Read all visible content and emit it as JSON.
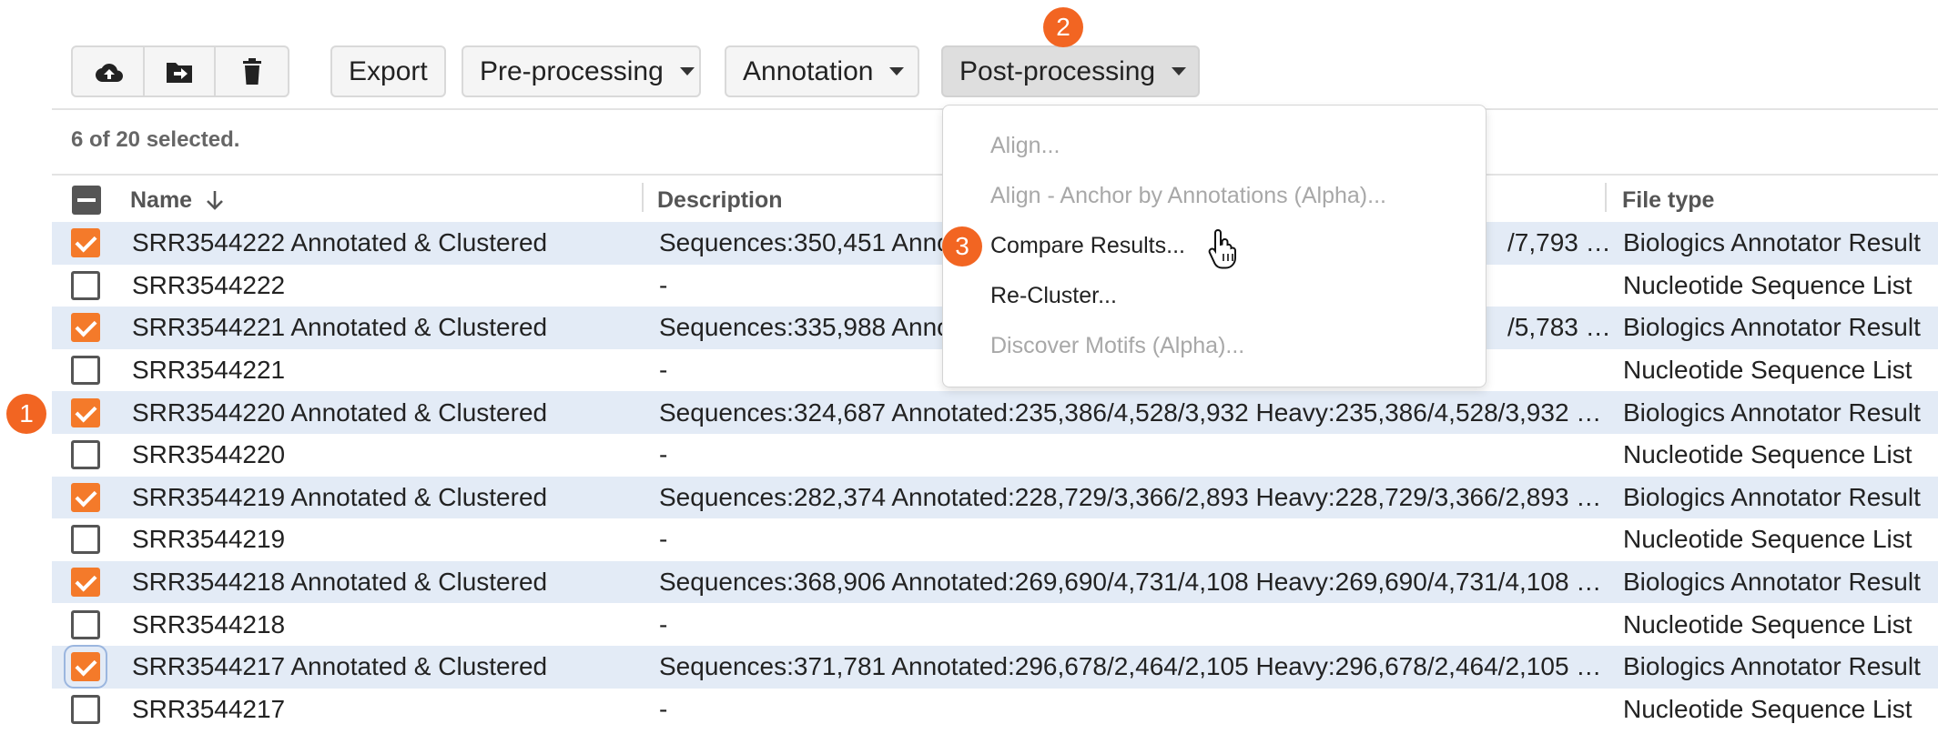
{
  "toolbar": {
    "icons": [
      "upload-cloud-icon",
      "move-to-folder-icon",
      "trash-icon"
    ],
    "export_label": "Export",
    "preprocessing_label": "Pre-processing",
    "annotation_label": "Annotation",
    "postprocessing_label": "Post-processing"
  },
  "selection_status": "6 of 20 selected.",
  "table": {
    "columns": {
      "name": "Name",
      "description": "Description",
      "file_type": "File type"
    },
    "rows": [
      {
        "checked": true,
        "name": "SRR3544222 Annotated & Clustered",
        "description": "Sequences:350,451 Anno",
        "description_tail": "/7,793 …",
        "file_type": "Biologics Annotator Result"
      },
      {
        "checked": false,
        "name": "SRR3544222",
        "description": "-",
        "description_tail": "",
        "file_type": "Nucleotide Sequence List"
      },
      {
        "checked": true,
        "name": "SRR3544221 Annotated & Clustered",
        "description": "Sequences:335,988 Anno",
        "description_tail": "/5,783 …",
        "file_type": "Biologics Annotator Result"
      },
      {
        "checked": false,
        "name": "SRR3544221",
        "description": "-",
        "description_tail": "",
        "file_type": "Nucleotide Sequence List"
      },
      {
        "checked": true,
        "name": "SRR3544220 Annotated & Clustered",
        "description": "Sequences:324,687 Annotated:235,386/4,528/3,932 Heavy:235,386/4,528/3,932 …",
        "description_tail": "",
        "file_type": "Biologics Annotator Result"
      },
      {
        "checked": false,
        "name": "SRR3544220",
        "description": "-",
        "description_tail": "",
        "file_type": "Nucleotide Sequence List"
      },
      {
        "checked": true,
        "name": "SRR3544219 Annotated & Clustered",
        "description": "Sequences:282,374 Annotated:228,729/3,366/2,893 Heavy:228,729/3,366/2,893 …",
        "description_tail": "",
        "file_type": "Biologics Annotator Result"
      },
      {
        "checked": false,
        "name": "SRR3544219",
        "description": "-",
        "description_tail": "",
        "file_type": "Nucleotide Sequence List"
      },
      {
        "checked": true,
        "name": "SRR3544218 Annotated & Clustered",
        "description": "Sequences:368,906 Annotated:269,690/4,731/4,108 Heavy:269,690/4,731/4,108 …",
        "description_tail": "",
        "file_type": "Biologics Annotator Result"
      },
      {
        "checked": false,
        "name": "SRR3544218",
        "description": "-",
        "description_tail": "",
        "file_type": "Nucleotide Sequence List"
      },
      {
        "checked": true,
        "name": "SRR3544217 Annotated & Clustered",
        "description": "Sequences:371,781 Annotated:296,678/2,464/2,105 Heavy:296,678/2,464/2,105 …",
        "description_tail": "",
        "file_type": "Biologics Annotator Result"
      },
      {
        "checked": false,
        "name": "SRR3544217",
        "description": "-",
        "description_tail": "",
        "file_type": "Nucleotide Sequence List"
      }
    ]
  },
  "postprocessing_menu": {
    "items": [
      {
        "label": "Align...",
        "disabled": true
      },
      {
        "label": "Align - Anchor by Annotations (Alpha)...",
        "disabled": true
      },
      {
        "label": "Compare Results...",
        "disabled": false
      },
      {
        "label": "Re-Cluster...",
        "disabled": false
      },
      {
        "label": "Discover Motifs (Alpha)...",
        "disabled": true
      }
    ]
  },
  "step_badges": [
    "1",
    "2",
    "3"
  ],
  "colors": {
    "accent_orange": "#f26522",
    "checkbox_orange": "#f47a2a",
    "selected_row": "#e3ebf6"
  }
}
